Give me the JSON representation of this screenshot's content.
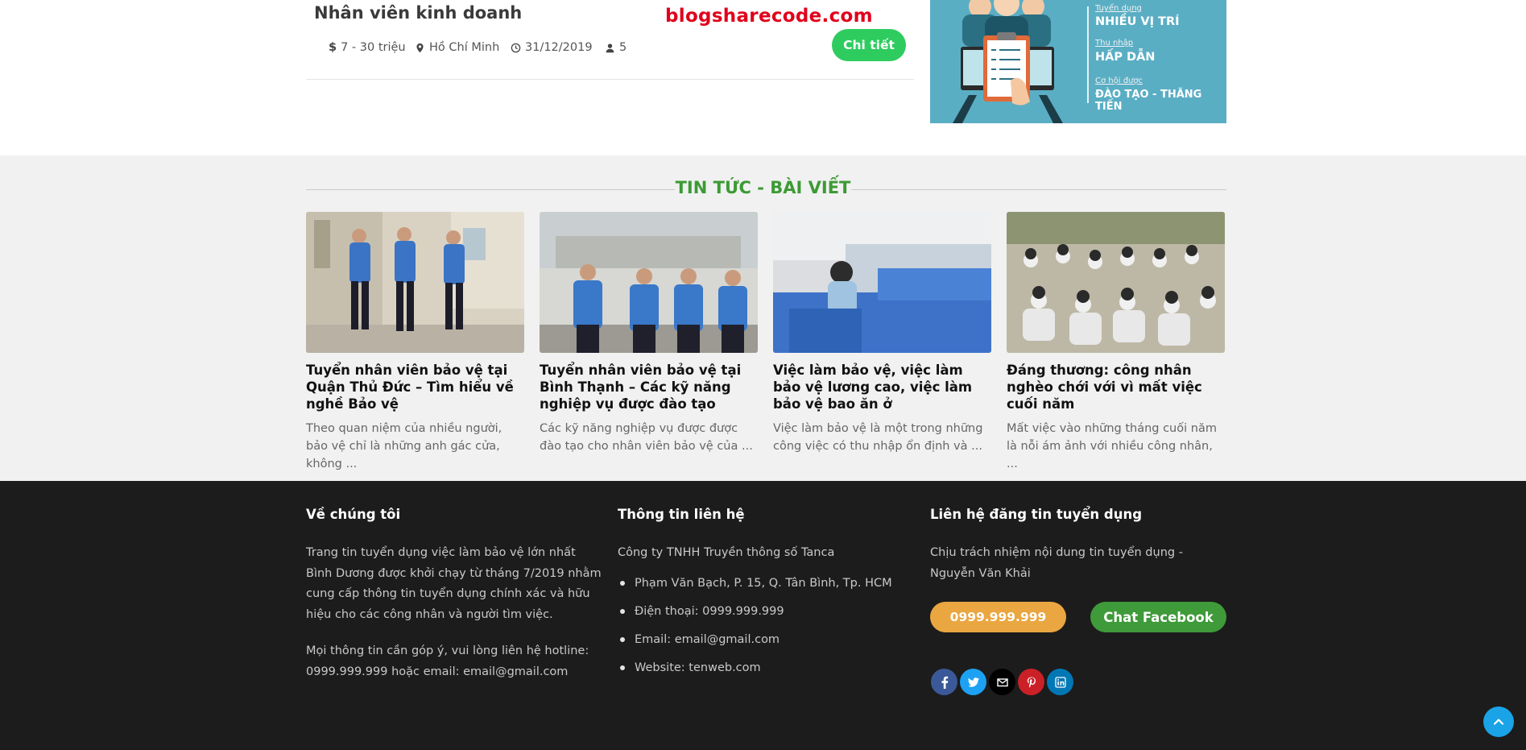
{
  "job": {
    "title": "Nhân viên kinh doanh",
    "salary": "7 - 30 triệu",
    "location": "Hồ Chí Minh",
    "deadline": "31/12/2019",
    "slots": "5",
    "detail_label": "Chi tiết"
  },
  "watermark": "blogsharecode.com",
  "banner": {
    "small1": "Tuyển dụng",
    "big1": "NHIỀU VỊ TRÍ",
    "small2": "Thu nhập",
    "big2": "HẤP DẪN",
    "small3": "Cơ hội được",
    "big3": "ĐÀO TẠO - THĂNG TIẾN"
  },
  "news": {
    "heading": "TIN TỨC - BÀI VIẾT",
    "items": [
      {
        "title": "Tuyển nhân viên bảo vệ tại Quận Thủ Đức – Tìm hiểu về nghề Bảo vệ",
        "desc": "Theo quan niệm của nhiều người, bảo vệ chỉ là những anh gác cửa, không ..."
      },
      {
        "title": "Tuyển nhân viên bảo vệ tại Bình Thạnh – Các kỹ năng nghiệp vụ được đào tạo",
        "desc": "Các kỹ năng nghiệp vụ được được đào tạo cho nhân viên bảo vệ của ..."
      },
      {
        "title": "Việc làm bảo vệ, việc làm bảo vệ lương cao, việc làm bảo vệ bao ăn ở",
        "desc": " Việc làm bảo vệ là một trong những công việc có thu nhập ổn định và ..."
      },
      {
        "title": "Đáng thương: công nhân nghèo chới với vì mất việc cuối năm",
        "desc": "Mất việc vào những tháng cuối năm là nỗi ám ảnh với nhiều công nhân, ..."
      }
    ]
  },
  "footer": {
    "about": {
      "heading": "Về chúng tôi",
      "p1": "Trang tin tuyển dụng việc làm bảo vệ lớn nhất Bình Dương được khởi chạy từ tháng 7/2019 nhằm cung cấp thông tin tuyển dụng chính xác và hữu hiệu cho các công nhân và người tìm việc.",
      "p2": "Mọi thông tin cần góp ý, vui lòng liên hệ hotline: 0999.999.999 hoặc email: email@gmail.com"
    },
    "contact": {
      "heading": "Thông tin liên hệ",
      "company": "Công ty TNHH Truyền thông số Tanca",
      "items": [
        "Phạm Văn Bạch, P. 15, Q. Tân Bình, Tp. HCM",
        "Điện thoại: 0999.999.999",
        "Email: email@gmail.com",
        "Website: tenweb.com"
      ]
    },
    "post": {
      "heading": "Liên hệ đăng tin tuyển dụng",
      "text": "Chịu trách nhiệm nội dung tin tuyển dụng - Nguyễn Văn Khải",
      "phone_label": "0999.999.999",
      "facebook_label": "Chat Facebook"
    },
    "social_icons": [
      "facebook-icon",
      "twitter-icon",
      "mail-icon",
      "pinterest-icon",
      "linkedin-icon"
    ]
  },
  "colors": {
    "accent_green": "#3c9a34",
    "button_green": "#2ecc5f",
    "phone_orange": "#eaa640",
    "watermark_red": "#e0001b",
    "footer_bg": "#1c1c1c",
    "scroll_top_blue": "#1aa3e6"
  }
}
